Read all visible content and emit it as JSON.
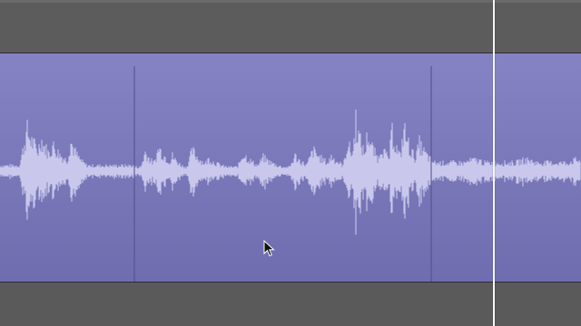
{
  "editor": {
    "tool": "audio-editor",
    "region_count": 3
  },
  "colors": {
    "background": "#5b5b5b",
    "track_top": "#8a88c6",
    "track_bottom": "#6e6cae",
    "waveform": "#c7c6ea",
    "region_divider": "#4d4b86",
    "playhead": "#f4f4f6"
  },
  "icons": {
    "cursor": "arrow-pointer-icon"
  }
}
